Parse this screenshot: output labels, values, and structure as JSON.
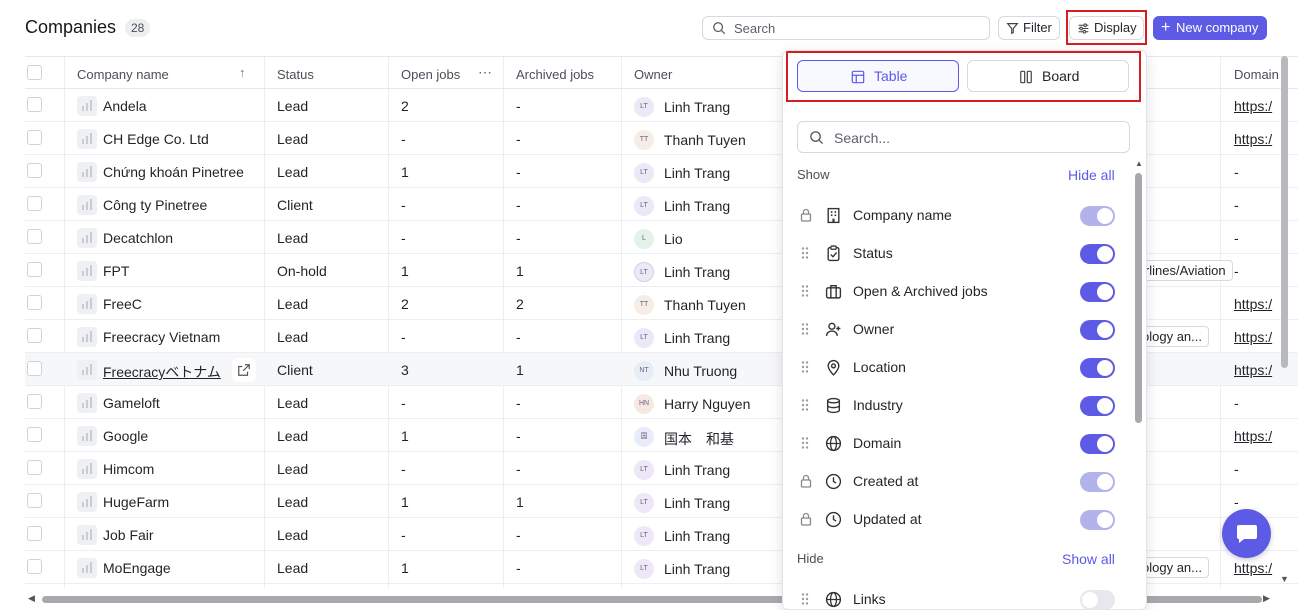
{
  "header": {
    "title": "Companies",
    "count": "28",
    "search_placeholder": "Search",
    "filter_label": "Filter",
    "display_label": "Display",
    "new_company_label": "New company"
  },
  "table": {
    "columns": [
      "Company name",
      "Status",
      "Open jobs",
      "Archived jobs",
      "Owner",
      "Domain"
    ],
    "rows": [
      {
        "name": "Andela",
        "status": "Lead",
        "open": "2",
        "archived": "-",
        "initials": "LT",
        "owner": "Linh Trang",
        "domain": "https:/"
      },
      {
        "name": "CH Edge Co. Ltd",
        "status": "Lead",
        "open": "-",
        "archived": "-",
        "initials": "TT",
        "owner": "Thanh Tuyen",
        "domain": "https:/"
      },
      {
        "name": "Chứng khoán Pinetree",
        "status": "Lead",
        "open": "1",
        "archived": "-",
        "initials": "LT",
        "owner": "Linh Trang",
        "domain": "-"
      },
      {
        "name": "Công ty Pinetree",
        "status": "Client",
        "open": "-",
        "archived": "-",
        "initials": "LT",
        "owner": "Linh Trang",
        "domain": "-"
      },
      {
        "name": "Decatchlon",
        "status": "Lead",
        "open": "-",
        "archived": "-",
        "initials": "L",
        "owner": "Lio",
        "domain": "-"
      },
      {
        "name": "FPT",
        "status": "On-hold",
        "open": "1",
        "archived": "1",
        "initials": "LT",
        "owner": "Linh Trang",
        "industry": "irlines/Aviation",
        "domain": "-"
      },
      {
        "name": "FreeC",
        "status": "Lead",
        "open": "2",
        "archived": "2",
        "initials": "TT",
        "owner": "Thanh Tuyen",
        "domain": "https:/"
      },
      {
        "name": "Freecracy Vietnam",
        "status": "Lead",
        "open": "-",
        "archived": "-",
        "initials": "LT",
        "owner": "Linh Trang",
        "industry": "ology an...",
        "domain": "https:/"
      },
      {
        "name": "Freecracyベトナム",
        "status": "Client",
        "open": "3",
        "archived": "1",
        "initials": "NT",
        "owner": "Nhu Truong",
        "domain": "https:/"
      },
      {
        "name": "Gameloft",
        "status": "Lead",
        "open": "-",
        "archived": "-",
        "initials": "HN",
        "owner": "Harry Nguyen",
        "domain": "-"
      },
      {
        "name": "Google",
        "status": "Lead",
        "open": "1",
        "archived": "-",
        "initials": "国",
        "owner": "国本　和基",
        "domain": "https:/"
      },
      {
        "name": "Himcom",
        "status": "Lead",
        "open": "-",
        "archived": "-",
        "initials": "LT",
        "owner": "Linh Trang",
        "domain": "-"
      },
      {
        "name": "HugeFarm",
        "status": "Lead",
        "open": "1",
        "archived": "1",
        "initials": "LT",
        "owner": "Linh Trang",
        "domain": "-"
      },
      {
        "name": "Job Fair",
        "status": "Lead",
        "open": "-",
        "archived": "-",
        "initials": "LT",
        "owner": "Linh Trang",
        "domain": "-"
      },
      {
        "name": "MoEngage",
        "status": "Lead",
        "open": "1",
        "archived": "-",
        "initials": "LT",
        "owner": "Linh Trang",
        "industry": "ology an...",
        "domain": "https:/"
      }
    ]
  },
  "display_panel": {
    "tab_table": "Table",
    "tab_board": "Board",
    "search_placeholder": "Search...",
    "show_label": "Show",
    "hide_all": "Hide all",
    "hide_label": "Hide",
    "show_all": "Show all",
    "shown": [
      {
        "label": "Company name",
        "icon": "building-icon",
        "locked": true,
        "enabled": true
      },
      {
        "label": "Status",
        "icon": "clipboard-check-icon",
        "locked": false,
        "enabled": true
      },
      {
        "label": "Open & Archived jobs",
        "icon": "briefcase-icon",
        "locked": false,
        "enabled": true
      },
      {
        "label": "Owner",
        "icon": "user-icon",
        "locked": false,
        "enabled": true
      },
      {
        "label": "Location",
        "icon": "map-pin-icon",
        "locked": false,
        "enabled": true
      },
      {
        "label": "Industry",
        "icon": "database-icon",
        "locked": false,
        "enabled": true
      },
      {
        "label": "Domain",
        "icon": "globe-icon",
        "locked": false,
        "enabled": true
      },
      {
        "label": "Created at",
        "icon": "clock-icon",
        "locked": true,
        "enabled": true
      },
      {
        "label": "Updated at",
        "icon": "clock-icon",
        "locked": true,
        "enabled": true
      }
    ],
    "hidden": [
      {
        "label": "Links",
        "icon": "globe-icon",
        "locked": false,
        "enabled": false
      }
    ]
  },
  "colors": {
    "accent": "#5d5be6",
    "highlight_box": "#d61e1e"
  }
}
